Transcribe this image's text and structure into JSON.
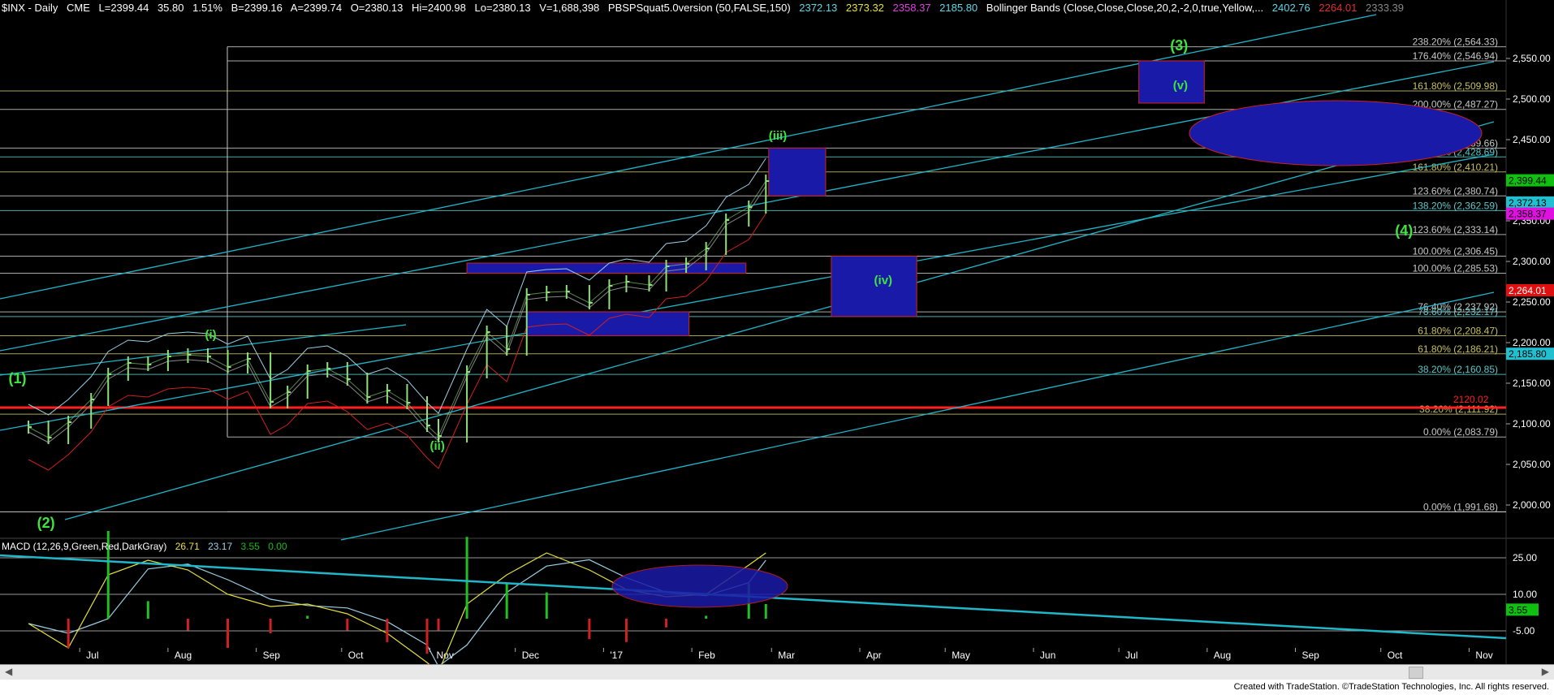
{
  "header": {
    "symbol": "$INX - Daily",
    "exchange": "CME",
    "last": "L=2399.44",
    "change": "35.80",
    "change_pct": "1.51%",
    "bid": "B=2399.16",
    "ask": "A=2399.74",
    "open": "O=2380.13",
    "high": "Hi=2400.98",
    "low": "Lo=2380.13",
    "volume": "V=1,688,398",
    "study": "PBSPSquat5.0version (50,FALSE,150)",
    "study_values": [
      "2372.13",
      "2373.32",
      "2358.37",
      "2185.80"
    ],
    "bands_name": "Bollinger Bands (Close,Close,Close,20,2,-2,0,true,Yellow,...",
    "bands_values": [
      "2402.76",
      "2264.01",
      "2333.39"
    ]
  },
  "macd_header": {
    "name": "MACD (12,26,9,Green,Red,DarkGray)",
    "values": [
      "26.71",
      "23.17",
      "3.55",
      "0.00"
    ]
  },
  "footer": {
    "credit": "Created with TradeStation. ©TradeStation Technologies, Inc. All rights reserved."
  },
  "colors": {
    "background": "#000000",
    "bars": "#8fe07a",
    "fib_line": "#c8c8c8",
    "channel": "#1fb7c9",
    "target_box": "#1a1aa8",
    "box_border": "#d02020",
    "support": "#ff2020",
    "wave_label": "#3ee53e",
    "macd_line": "#e5e03a",
    "signal_line": "#9ad0e6"
  },
  "chart_data": {
    "type": "line",
    "title": "$INX - Daily",
    "ylim": [
      1970,
      2600
    ],
    "y_ticks": [
      "2,550.00",
      "2,500.00",
      "2,450.00",
      "2,400.00",
      "2,350.00",
      "2,300.00",
      "2,250.00",
      "2,200.00",
      "2,150.00",
      "2,100.00",
      "2,050.00",
      "2,000.00"
    ],
    "x_ticks": [
      "Jul",
      "Aug",
      "Sep",
      "Oct",
      "Nov",
      "Dec",
      "'17",
      "Feb",
      "Mar",
      "Apr",
      "May",
      "Jun",
      "Jul",
      "Aug",
      "Sep",
      "Oct",
      "Nov"
    ],
    "series": [
      {
        "name": "$INX",
        "x": [
          "2016-06-13",
          "2016-06-20",
          "2016-06-27",
          "2016-07-05",
          "2016-07-11",
          "2016-07-18",
          "2016-07-25",
          "2016-08-01",
          "2016-08-08",
          "2016-08-15",
          "2016-08-22",
          "2016-08-29",
          "2016-09-06",
          "2016-09-12",
          "2016-09-19",
          "2016-09-26",
          "2016-10-03",
          "2016-10-10",
          "2016-10-17",
          "2016-10-24",
          "2016-10-31",
          "2016-11-04",
          "2016-11-14",
          "2016-11-21",
          "2016-11-28",
          "2016-12-05",
          "2016-12-12",
          "2016-12-19",
          "2016-12-27",
          "2017-01-03",
          "2017-01-09",
          "2017-01-17",
          "2017-01-23",
          "2017-01-30",
          "2017-02-06",
          "2017-02-13",
          "2017-02-21",
          "2017-02-27"
        ],
        "values": [
          2096,
          2083,
          2102,
          2130,
          2161,
          2175,
          2173,
          2183,
          2185,
          2183,
          2170,
          2180,
          2127,
          2139,
          2165,
          2168,
          2155,
          2133,
          2141,
          2126,
          2098,
          2085,
          2164,
          2213,
          2192,
          2259,
          2262,
          2263,
          2249,
          2270,
          2275,
          2271,
          2294,
          2297,
          2316,
          2351,
          2367,
          2399
        ]
      },
      {
        "name": "MACD",
        "x": [
          "2016-06-13",
          "2016-06-27",
          "2016-07-11",
          "2016-07-25",
          "2016-08-08",
          "2016-08-22",
          "2016-09-06",
          "2016-09-19",
          "2016-10-03",
          "2016-10-17",
          "2016-10-31",
          "2016-11-04",
          "2016-11-14",
          "2016-11-28",
          "2016-12-12",
          "2016-12-27",
          "2017-01-09",
          "2017-01-23",
          "2017-02-06",
          "2017-02-21",
          "2017-02-27"
        ],
        "values": [
          -2,
          -12,
          18,
          24,
          20,
          10,
          5,
          6,
          2,
          -6,
          -18,
          -22,
          6,
          18,
          27,
          20,
          12,
          9,
          10,
          22,
          27
        ]
      }
    ],
    "fib_levels": [
      {
        "label": "238.20% (2,564.33)",
        "value": 2564.33,
        "color": "#c8c8c8"
      },
      {
        "label": "176.40% (2,546.94)",
        "value": 2546.94,
        "color": "#c8c8c8"
      },
      {
        "label": "161.80% (2,509.98)",
        "value": 2509.98,
        "color": "#c8c060"
      },
      {
        "label": "200.00% (2,487.27)",
        "value": 2487.27,
        "color": "#c8c8c8"
      },
      {
        "label": "176.40% (2,439.66)",
        "value": 2439.66,
        "color": "#c8c8c8"
      },
      {
        "label": "150.20% (2,428.69)",
        "value": 2428.69,
        "color": "#5fc8c8"
      },
      {
        "label": "161.80% (2,410.21)",
        "value": 2410.21,
        "color": "#c8c060"
      },
      {
        "label": "123.60% (2,380.74)",
        "value": 2380.74,
        "color": "#c8c8c8"
      },
      {
        "label": "138.20% (2,362.59)",
        "value": 2362.59,
        "color": "#5fc8c8"
      },
      {
        "label": "123.60% (2,333.14)",
        "value": 2333.14,
        "color": "#c8c8c8"
      },
      {
        "label": "100.00% (2,306.45)",
        "value": 2306.45,
        "color": "#c8c8c8"
      },
      {
        "label": "100.00% (2,285.53)",
        "value": 2285.53,
        "color": "#c8c8c8"
      },
      {
        "label": "76.40% (2,237.92)",
        "value": 2237.92,
        "color": "#c8c8c8"
      },
      {
        "label": "78.60% (2,232.17)",
        "value": 2232.17,
        "color": "#5fc8c8"
      },
      {
        "label": "61.80% (2,208.47)",
        "value": 2208.47,
        "color": "#c8c060"
      },
      {
        "label": "61.80% (2,186.21)",
        "value": 2186.21,
        "color": "#c8c060"
      },
      {
        "label": "38.20% (2,160.85)",
        "value": 2160.85,
        "color": "#5fc8c8"
      },
      {
        "label": "38.20% (2,111.92)",
        "value": 2111.92,
        "color": "#c8c060"
      },
      {
        "label": "0.00% (2,083.79)",
        "value": 2083.79,
        "color": "#c8c8c8"
      },
      {
        "label": "0.00% (1,991.68)",
        "value": 1991.68,
        "color": "#c8c8c8"
      }
    ],
    "support_line": {
      "label": "2120.02",
      "value": 2120.02
    },
    "price_tags": [
      {
        "label": "2,399.44",
        "value": 2399.44,
        "bg": "#10c010",
        "fg": "#000000"
      },
      {
        "label": "2,372.13",
        "value": 2372.13,
        "bg": "#20c0d0",
        "fg": "#000000"
      },
      {
        "label": "2,358.37",
        "value": 2358.37,
        "bg": "#e010e0",
        "fg": "#000000"
      },
      {
        "label": "2,264.01",
        "value": 2264.01,
        "bg": "#e01010",
        "fg": "#ffffff"
      },
      {
        "label": "2,185.80",
        "value": 2185.8,
        "bg": "#20c0d0",
        "fg": "#000000"
      }
    ],
    "wave_labels": [
      "(1)",
      "(2)",
      "(i)",
      "(ii)",
      "(iii)",
      "(iv)",
      "(v)",
      "(3)",
      "(4)"
    ],
    "macd_ylim": [
      -12,
      30
    ],
    "macd_ticks": [
      "25.00",
      "10.00",
      "-5.00"
    ],
    "macd_tag": {
      "label": "3.55",
      "value": 3.55
    }
  }
}
